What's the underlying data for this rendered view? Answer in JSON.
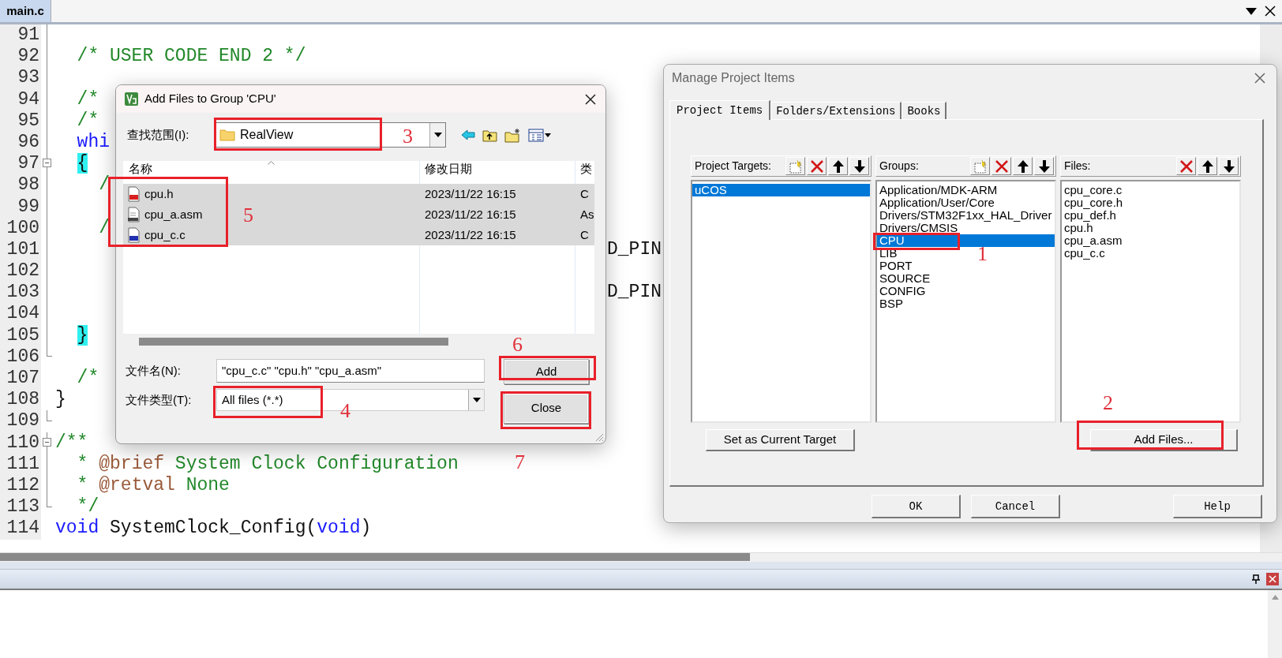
{
  "editor": {
    "tab": {
      "label": "main.c",
      "selected": true
    },
    "lines": [
      {
        "number": "91"
      },
      {
        "number": "92",
        "tokens": [
          {
            "text": "  /* USER CODE END 2 */",
            "kind": "comment"
          }
        ]
      },
      {
        "number": "93"
      },
      {
        "number": "94",
        "tokens": [
          {
            "text": "  /*",
            "kind": "comment"
          }
        ]
      },
      {
        "number": "95",
        "tokens": [
          {
            "text": "  /*",
            "kind": "comment"
          }
        ]
      },
      {
        "number": "96",
        "tokens": [
          {
            "text": "  whi",
            "kind": "keyword"
          }
        ]
      },
      {
        "number": "97",
        "fold_start": true,
        "indented": true,
        "tokens": [
          {
            "text": "{",
            "kind": "brace"
          }
        ]
      },
      {
        "number": "98",
        "tokens": [
          {
            "text": "    /",
            "kind": "comment"
          }
        ]
      },
      {
        "number": "99"
      },
      {
        "number": "100",
        "tokens": [
          {
            "text": "    /",
            "kind": "comment"
          }
        ]
      },
      {
        "number": "101",
        "tail": "D_PIN"
      },
      {
        "number": "102"
      },
      {
        "number": "103",
        "tail": "D_PIN"
      },
      {
        "number": "104"
      },
      {
        "number": "105",
        "indented": true,
        "tokens": [
          {
            "text": "}",
            "kind": "brace"
          }
        ]
      },
      {
        "number": "106",
        "fold_end": true
      },
      {
        "number": "107",
        "tokens": [
          {
            "text": "  /*",
            "kind": "comment"
          }
        ]
      },
      {
        "number": "108",
        "tokens": [
          {
            "text": "}",
            "kind": "plain"
          }
        ]
      },
      {
        "number": "109",
        "fold_end": true
      },
      {
        "number": "110",
        "fold_start": true,
        "tokens": [
          {
            "text": "/**",
            "kind": "comment"
          }
        ]
      },
      {
        "number": "111",
        "tokens": [
          {
            "text": "  * ",
            "kind": "comment"
          },
          {
            "text": "@brief",
            "kind": "doc_tag"
          },
          {
            "text": " System Clock Configuration",
            "kind": "comment"
          }
        ]
      },
      {
        "number": "112",
        "tokens": [
          {
            "text": "  * ",
            "kind": "comment"
          },
          {
            "text": "@retval",
            "kind": "doc_tag"
          },
          {
            "text": " None",
            "kind": "comment"
          }
        ]
      },
      {
        "number": "113",
        "fold_end": true,
        "tokens": [
          {
            "text": "  */",
            "kind": "comment"
          }
        ]
      },
      {
        "number": "114",
        "tokens": [
          {
            "text": "void",
            "kind": "keyword"
          },
          {
            "text": " SystemClock_Config(",
            "kind": "plain"
          },
          {
            "text": "void",
            "kind": "keyword"
          },
          {
            "text": ")",
            "kind": "plain"
          }
        ]
      }
    ]
  },
  "add_files_dialog": {
    "title": "Add Files to Group 'CPU'",
    "look_in": {
      "label": "查找范围(I):",
      "value": "RealView"
    },
    "file_list": {
      "columns": [
        "名称",
        "修改日期",
        "类"
      ],
      "rows": [
        {
          "name": "cpu.h",
          "date": "2023/11/22 16:15",
          "type": "C",
          "kind": "header",
          "selected": true
        },
        {
          "name": "cpu_a.asm",
          "date": "2023/11/22 16:15",
          "type": "As",
          "kind": "asm",
          "selected": true
        },
        {
          "name": "cpu_c.c",
          "date": "2023/11/22 16:15",
          "type": "C",
          "kind": "c",
          "selected": true
        }
      ]
    },
    "file_name": {
      "label": "文件名(N):",
      "value": "\"cpu_c.c\" \"cpu.h\" \"cpu_a.asm\""
    },
    "file_type": {
      "label": "文件类型(T):",
      "value": "All files (*.*)"
    },
    "buttons": [
      "Add",
      "Close"
    ]
  },
  "manage_dialog": {
    "title": "Manage Project Items",
    "tabs": [
      {
        "label": "Project Items",
        "selected": true
      },
      {
        "label": "Folders/Extensions",
        "selected": false
      },
      {
        "label": "Books",
        "selected": false
      }
    ],
    "panels": [
      {
        "title": "Project Targets:",
        "tools": [
          {
            "kind": "new"
          },
          {
            "kind": "delete"
          },
          {
            "kind": "up"
          },
          {
            "kind": "down"
          }
        ],
        "items": [
          {
            "label": "uCOS",
            "selected": true
          }
        ],
        "button": "Set as Current Target"
      },
      {
        "title": "Groups:",
        "tools": [
          {
            "kind": "new"
          },
          {
            "kind": "delete"
          },
          {
            "kind": "up"
          },
          {
            "kind": "down"
          }
        ],
        "items": [
          {
            "label": "Application/MDK-ARM",
            "selected": false
          },
          {
            "label": "Application/User/Core",
            "selected": false
          },
          {
            "label": "Drivers/STM32F1xx_HAL_Driver",
            "selected": false
          },
          {
            "label": "Drivers/CMSIS",
            "selected": false
          },
          {
            "label": "CPU",
            "selected": true
          },
          {
            "label": "LIB",
            "selected": false
          },
          {
            "label": "PORT",
            "selected": false
          },
          {
            "label": "SOURCE",
            "selected": false
          },
          {
            "label": "CONFIG",
            "selected": false
          },
          {
            "label": "BSP",
            "selected": false
          }
        ]
      },
      {
        "title": "Files:",
        "tools": [
          {
            "kind": "delete"
          },
          {
            "kind": "up"
          },
          {
            "kind": "down"
          }
        ],
        "items": [
          {
            "label": "cpu_core.c",
            "selected": false
          },
          {
            "label": "cpu_core.h",
            "selected": false
          },
          {
            "label": "cpu_def.h",
            "selected": false
          },
          {
            "label": "cpu.h",
            "selected": false
          },
          {
            "label": "cpu_a.asm",
            "selected": false
          },
          {
            "label": "cpu_c.c",
            "selected": false
          }
        ],
        "button": "Add Files..."
      }
    ],
    "buttons": [
      "OK",
      "Cancel",
      "Help"
    ]
  },
  "annotations": [
    {
      "label": "3"
    },
    {
      "label": "5"
    },
    {
      "label": "6"
    },
    {
      "label": "4"
    },
    {
      "label": "7"
    },
    {
      "label": "1"
    },
    {
      "label": "2"
    }
  ]
}
